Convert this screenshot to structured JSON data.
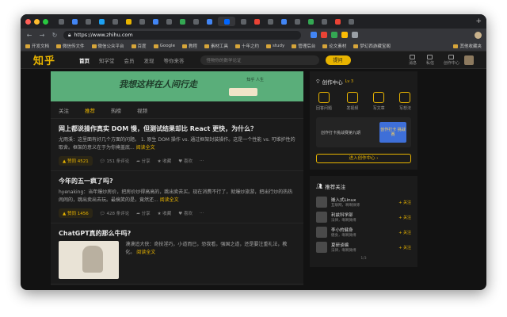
{
  "browser": {
    "url": "https://www.zhihu.com",
    "bookmarks": [
      "开发文档",
      "微信传文件",
      "微信公众平台",
      "百度",
      "Google",
      "教程",
      "素材工具",
      "十年之约",
      "study",
      "管理后台",
      "论文素材",
      "梦幻西游藏宝阁"
    ],
    "bookmarks_right": "其他收藏夹"
  },
  "site": {
    "logo": "知乎",
    "nav": [
      "首页",
      "知学堂",
      "会员",
      "发现",
      "等你来答"
    ],
    "search_placeholder": "怪物你的数学论证",
    "ask": "提问",
    "header_icons": [
      "消息",
      "私信",
      "创作中心"
    ]
  },
  "banner": {
    "text": "我想这样在人间行走",
    "sub": "知乎 人生"
  },
  "feed_tabs": [
    "关注",
    "推荐",
    "热榜",
    "视频"
  ],
  "posts": [
    {
      "title": "网上都说操作真实 DOM 慢，但测试结果却比 React 更快，为什么？",
      "excerpt": "尤雨溪：这里面有好几个方面的问题。 1. 原生 DOM 操作 vs. 通过框架封装操作。这是一个性能 vs. 可维护性的取舍。框架的意义在于为你掩盖底...",
      "more": "阅读全文",
      "vote": "▲ 赞同 4521",
      "comments": "151 条评论",
      "share": "分享",
      "collect": "收藏",
      "like": "喜欢"
    },
    {
      "title": "今年的五一疯了吗?",
      "excerpt": "hyenaking：当年爆炒房价，把房价炒得高高的，跳出卖去买。现在消费不行了，就爆炒旅游，把出行炒的热热闹闹的，跳出卖出去玩。最搞笑的是，竟然还...",
      "more": "阅读全文",
      "vote": "▲ 赞同 1456",
      "comments": "428 条评论",
      "share": "分享",
      "collect": "收藏",
      "like": "喜欢"
    },
    {
      "title": "ChatGPT真的那么牛吗?",
      "excerpt": "漠漠追大侠：奇技淫巧，小道而已，恐我看，强国之道，还是要注重礼法，教化。",
      "more": "阅读全文"
    }
  ],
  "creator": {
    "title": "创作中心",
    "level": "Lv 3",
    "items": [
      "回答问题",
      "发视频",
      "写文章",
      "写想法"
    ],
    "promo_text": "创作打卡挑战赛第九期",
    "promo_img": "创作打卡 挑战赛",
    "enter": "进入创作中心 ›"
  },
  "recommend": {
    "title": "推荐关注",
    "items": [
      {
        "name": "嵌入式Linux",
        "desc": "互联网，啊啊微博",
        "follow": "+ 关注"
      },
      {
        "name": "利兹科学部",
        "desc": "法律，啊啊微博",
        "follow": "+ 关注"
      },
      {
        "name": "李小的健身",
        "desc": "健身，啊啊微博",
        "follow": "+ 关注"
      },
      {
        "name": "夏研谈编",
        "desc": "法律，啊啊微博",
        "follow": "+ 关注"
      }
    ],
    "pager": "1/3"
  },
  "colors": {
    "accent": "#e8b400",
    "banner": "#5aae7a",
    "bg": "#121212"
  }
}
